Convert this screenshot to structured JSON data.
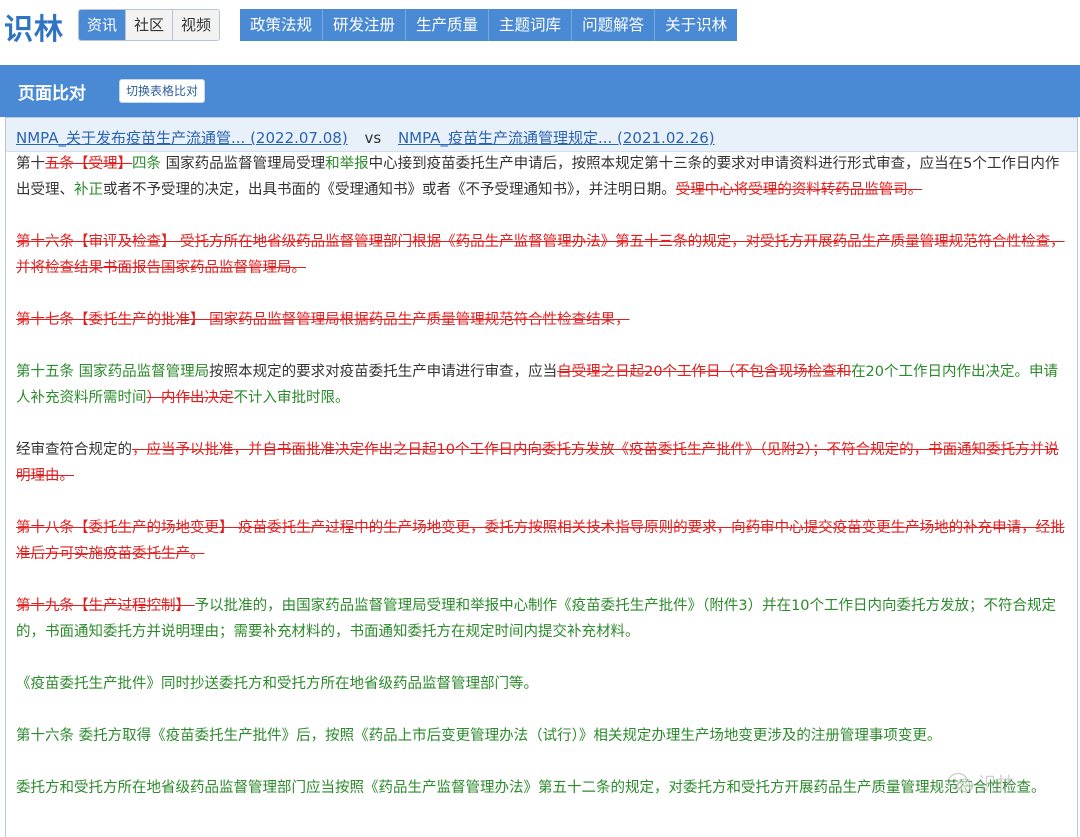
{
  "site": {
    "logo": "识林"
  },
  "segment": [
    "资讯",
    "社区",
    "视频"
  ],
  "nav": [
    "政策法规",
    "研发注册",
    "生产质量",
    "主题词库",
    "问题解答",
    "关于识林"
  ],
  "header": {
    "title": "页面比对",
    "switch_label": "切换表格比对"
  },
  "compare": {
    "left_title": "NMPA_关于发布疫苗生产流通管... (2022.07.08)",
    "vs": "vs",
    "right_title": "NMPA_疫苗生产流通管理规定... (2021.02.26)"
  },
  "diff": [
    [
      {
        "t": "第十",
        "k": "same"
      },
      {
        "t": "五条【受理】",
        "k": "del"
      },
      {
        "t": "四条",
        "k": "ins"
      },
      {
        "t": " 国家药品监督管理局受理",
        "k": "same"
      },
      {
        "t": "和举报",
        "k": "ins"
      },
      {
        "t": "中心接到疫苗委托生产申请后，按照本规定第十三条的要求对申请资料进行形式审查，应当在5个工作日内作出受理、",
        "k": "same"
      },
      {
        "t": "补正",
        "k": "ins"
      },
      {
        "t": "或者不予受理的决定，出具书面的《受理通知书》或者《不予受理通知书》，并注明日期。",
        "k": "same"
      },
      {
        "t": "受理中心将受理的资料转药品监管司。",
        "k": "del"
      }
    ],
    [
      {
        "t": "第十六条【审评及检查】 受托方所在地省级药品监督管理部门根据《药品生产监督管理办法》第五十三条的规定，对受托方开展药品生产质量管理规范符合性检查，并将检查结果书面报告国家药品监督管理局。",
        "k": "del"
      }
    ],
    [
      {
        "t": "第十七条【委托生产的批准】 国家药品监督管理局根据药品生产质量管理规范符合性检查结果，",
        "k": "del"
      }
    ],
    [
      {
        "t": "第十五条 国家药品监督管理局",
        "k": "ins"
      },
      {
        "t": "按照本规定的要求对疫苗委托生产申请进行审查，应当",
        "k": "same"
      },
      {
        "t": "自受理之日起20个工作日（不包含现场检查和",
        "k": "del"
      },
      {
        "t": "在20个工作日内作出决定。申请人补充资料所需时间",
        "k": "ins"
      },
      {
        "t": "）内作出决定",
        "k": "del"
      },
      {
        "t": "不计入审批时限。",
        "k": "ins"
      }
    ],
    [
      {
        "t": "经审查符合规定的",
        "k": "same"
      },
      {
        "t": "，应当予以批准，并自书面批准决定作出之日起10个工作日内向委托方发放《疫苗委托生产批件》（见附2）；不符合规定的，书面通知委托方并说明理由。",
        "k": "del"
      }
    ],
    [
      {
        "t": "第十八条【委托生产的场地变更】 疫苗委托生产过程中的生产场地变更，委托方按照相关技术指导原则的要求，向药审中心提交疫苗变更生产场地的补充申请，经批准后方可实施疫苗委托生产。",
        "k": "del"
      }
    ],
    [
      {
        "t": "第十九条【生产过程控制】 ",
        "k": "del"
      },
      {
        "t": "予以批准的，由国家药品监督管理局受理和举报中心制作《疫苗委托生产批件》（附件3）并在10个工作日内向委托方发放；不符合规定的，书面通知委托方并说明理由；需要补充材料的，书面通知委托方在规定时间内提交补充材料。",
        "k": "ins"
      }
    ],
    [
      {
        "t": "《疫苗委托生产批件》同时抄送委托方和受托方所在地省级药品监督管理部门等。",
        "k": "ins"
      }
    ],
    [
      {
        "t": "第十六条 委托方取得《疫苗委托生产批件》后，按照《药品上市后变更管理办法（试行）》相关规定办理生产场地变更涉及的注册管理事项变更。",
        "k": "ins"
      }
    ],
    [
      {
        "t": "委托方和受托方所在地省级药品监督管理部门应当按照《药品生产监督管理办法》第五十二条的规定，对委托方和受托方开展药品生产质量管理规范符合性检查。",
        "k": "ins"
      }
    ]
  ],
  "watermark": {
    "text": "识林",
    "icon": "wechat-icon"
  }
}
